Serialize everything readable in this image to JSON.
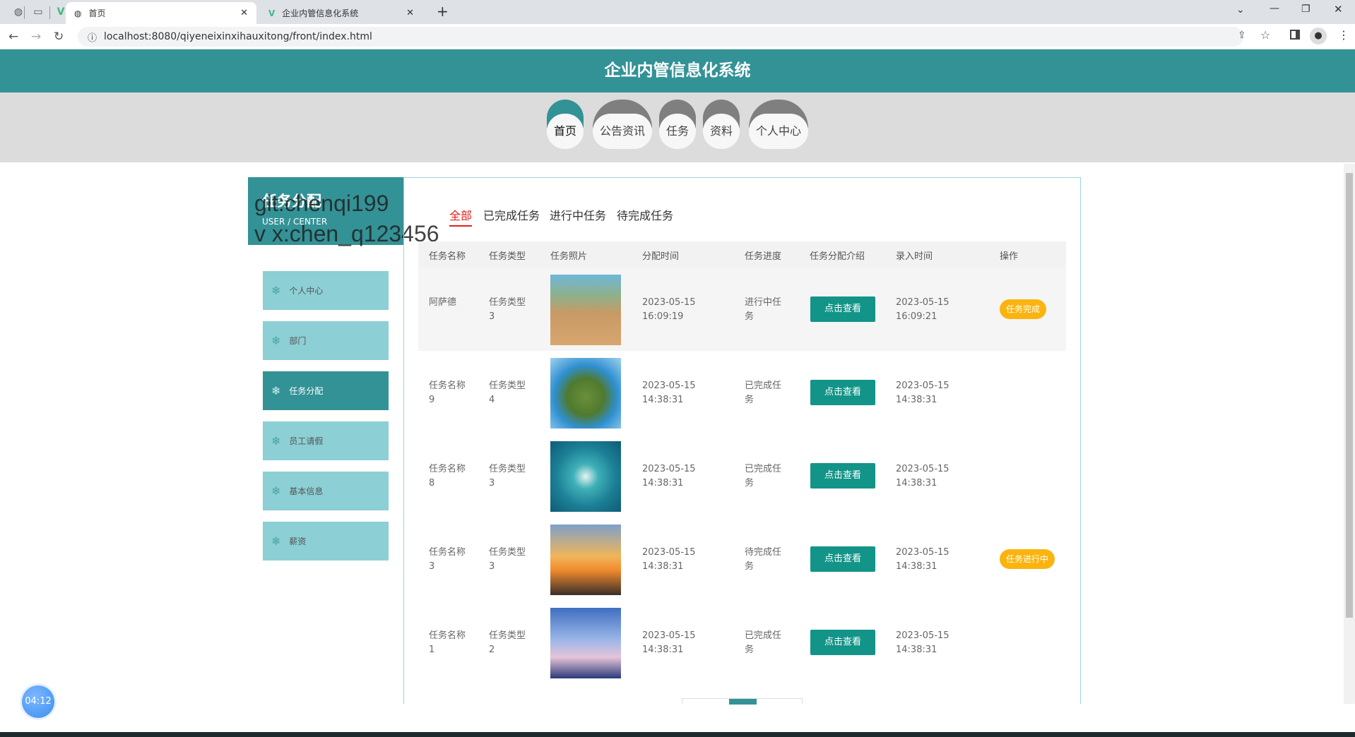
{
  "browser": {
    "tabs": [
      {
        "label": "首页",
        "active": true
      },
      {
        "label": "企业内管信息化系统",
        "active": false
      }
    ],
    "url": "localhost:8080/qiyeneixinxihauxitong/front/index.html"
  },
  "header": {
    "title": "企业内管信息化系统"
  },
  "nav": [
    "首页",
    "公告资讯",
    "任务",
    "资料",
    "个人中心"
  ],
  "section": {
    "title": "任务分配",
    "subtitle": "USER / CENTER"
  },
  "watermark": [
    "git:chenqi199",
    "v x:chen_q123456"
  ],
  "sidebar": [
    "个人中心",
    "部门",
    "任务分配",
    "员工请假",
    "基本信息",
    "薪资"
  ],
  "filters": [
    "全部",
    "已完成任务",
    "进行中任务",
    "待完成任务"
  ],
  "table": {
    "headers": [
      "任务名称",
      "任务类型",
      "任务照片",
      "分配时间",
      "任务进度",
      "任务分配介绍",
      "录入时间",
      "操作"
    ],
    "view_label": "点击查看",
    "rows": [
      {
        "name": "阿萨德",
        "type": "任务类型3",
        "assigned": [
          "2023-05-15",
          "16:09:19"
        ],
        "progress": "进行中任务",
        "created": [
          "2023-05-15",
          "16:09:21"
        ],
        "action": "任务完成"
      },
      {
        "name": "任务名称9",
        "type": "任务类型4",
        "assigned": [
          "2023-05-15",
          "14:38:31"
        ],
        "progress": "已完成任务",
        "created": [
          "2023-05-15",
          "14:38:31"
        ],
        "action": ""
      },
      {
        "name": "任务名称8",
        "type": "任务类型3",
        "assigned": [
          "2023-05-15",
          "14:38:31"
        ],
        "progress": "已完成任务",
        "created": [
          "2023-05-15",
          "14:38:31"
        ],
        "action": ""
      },
      {
        "name": "任务名称3",
        "type": "任务类型3",
        "assigned": [
          "2023-05-15",
          "14:38:31"
        ],
        "progress": "待完成任务",
        "created": [
          "2023-05-15",
          "14:38:31"
        ],
        "action": "任务进行中"
      },
      {
        "name": "任务名称1",
        "type": "任务类型2",
        "assigned": [
          "2023-05-15",
          "14:38:31"
        ],
        "progress": "已完成任务",
        "created": [
          "2023-05-15",
          "14:38:31"
        ],
        "action": ""
      }
    ]
  },
  "timer": "04:12",
  "colors": {
    "primary": "#339296",
    "button": "#139488",
    "badge": "#fbb40f",
    "active_tab": "#e02020"
  }
}
